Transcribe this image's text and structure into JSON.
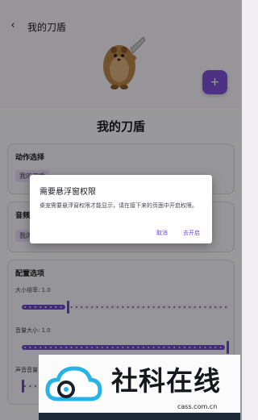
{
  "header": {
    "title": "我的刀盾",
    "back_icon": "arrow-back-icon"
  },
  "fab": {
    "icon": "plus-icon",
    "label": "+"
  },
  "page_title": "我的刀盾",
  "action_card": {
    "title": "动作选择",
    "chip_label": "我的刀盾"
  },
  "audio_card": {
    "title": "音频",
    "chip_label": "我的"
  },
  "config_card": {
    "title": "配置选项",
    "sliders": [
      {
        "label": "大小倍率: 1.0",
        "value_fraction": 0.22
      },
      {
        "label": "音量大小: 1.0",
        "value_fraction": 1.0
      },
      {
        "label": "声音音量",
        "value_fraction": 0.0
      }
    ]
  },
  "dialog": {
    "title": "需要悬浮窗权限",
    "body": "桌宠需要悬浮窗权限才能显示，请在接下来的页面中开启权限。",
    "cancel_label": "取消",
    "confirm_label": "去开启"
  },
  "watermark": {
    "text": "社科在线",
    "url": "cass.com.cn"
  },
  "colors": {
    "accent": "#6d48c9",
    "fab": "#7b4fd6",
    "scrim": "rgba(0,0,0,0.38)"
  }
}
